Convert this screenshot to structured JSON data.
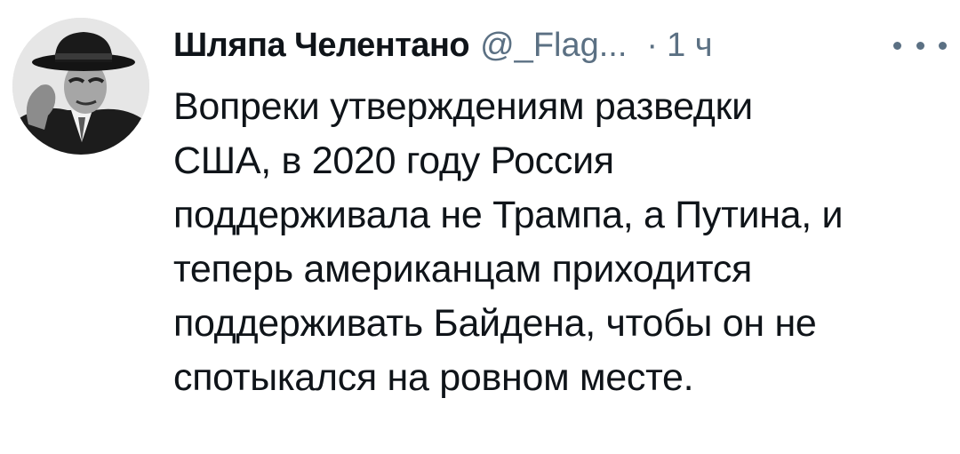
{
  "tweet": {
    "author": {
      "display_name": "Шляпа Челентано",
      "handle": "@_Flag...",
      "avatar_icon": "person-in-hat-avatar"
    },
    "separator": "·",
    "timestamp": "1 ч",
    "more_icon": "more-horizontal-icon",
    "text_lines": [
      "Вопреки утверждениям разведки",
      "США, в 2020 году Россия",
      "поддерживала не Трампа, а Путина, и",
      "теперь американцам приходится",
      "поддерживать Байдена, чтобы он не",
      "спотыкался на ровном месте."
    ]
  },
  "colors": {
    "text": "#0f1419",
    "secondary": "#5b7083",
    "background": "#ffffff"
  }
}
